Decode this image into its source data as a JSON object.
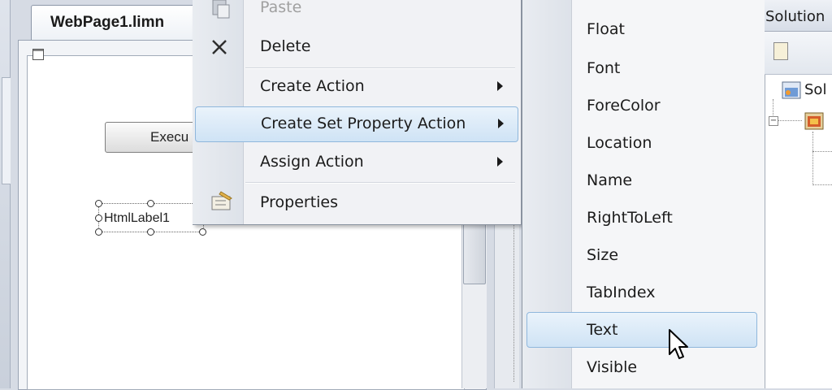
{
  "document_tab": {
    "title": "WebPage1.limn"
  },
  "designer": {
    "button_label": "Execu",
    "label_control": "HtmlLabel1"
  },
  "context_menu": {
    "items": [
      {
        "label": "Paste",
        "icon": "paste-icon",
        "enabled": false
      },
      {
        "label": "Delete",
        "icon": "delete-icon",
        "enabled": true
      },
      {
        "label": "Create Action",
        "has_submenu": true
      },
      {
        "label": "Create Set Property Action",
        "has_submenu": true,
        "highlighted": true
      },
      {
        "label": "Assign Action",
        "has_submenu": true
      },
      {
        "label": "Properties",
        "icon": "properties-icon",
        "enabled": true
      }
    ]
  },
  "submenu": {
    "items": [
      {
        "label": "Float"
      },
      {
        "label": "Font"
      },
      {
        "label": "ForeColor"
      },
      {
        "label": "Location"
      },
      {
        "label": "Name"
      },
      {
        "label": "RightToLeft"
      },
      {
        "label": "Size"
      },
      {
        "label": "TabIndex"
      },
      {
        "label": "Text",
        "highlighted": true
      },
      {
        "label": "Visible"
      }
    ]
  },
  "solution_explorer": {
    "title": "Solution",
    "root_label": "Sol"
  },
  "colors": {
    "highlight_border": "#8fb7dc",
    "highlight_fill": "#cfe3f5",
    "menu_background": "#f1f2f5"
  }
}
